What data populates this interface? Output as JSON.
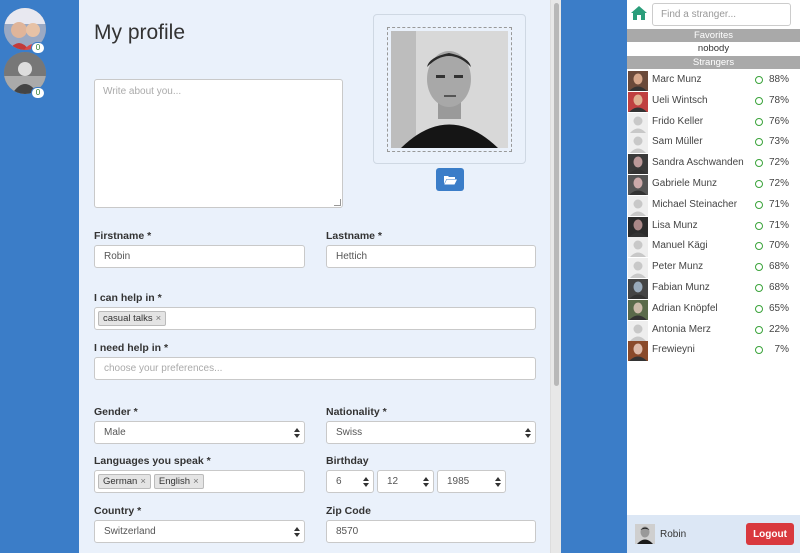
{
  "chats": [
    {
      "badge": "0"
    },
    {
      "badge": "0"
    }
  ],
  "profile": {
    "title": "My profile",
    "about_placeholder": "Write about you...",
    "firstname_label": "Firstname *",
    "firstname_value": "Robin",
    "lastname_label": "Lastname *",
    "lastname_value": "Hettich",
    "help_in_label": "I can help in *",
    "help_in_tags": [
      "casual talks"
    ],
    "need_help_label": "I need help in *",
    "need_help_placeholder": "choose your preferences...",
    "gender_label": "Gender *",
    "gender_value": "Male",
    "nationality_label": "Nationality *",
    "nationality_value": "Swiss",
    "languages_label": "Languages you speak *",
    "languages_tags": [
      "German",
      "English"
    ],
    "birthday_label": "Birthday",
    "birthday_day": "6",
    "birthday_month": "12",
    "birthday_year": "1985",
    "country_label": "Country *",
    "country_value": "Switzerland",
    "zip_label": "Zip Code",
    "zip_value": "8570",
    "tag_remove": "×"
  },
  "sidebar": {
    "search_placeholder": "Find a stranger...",
    "favorites_label": "Favorites",
    "favorites_empty": "nobody",
    "strangers_label": "Strangers",
    "status_color": "#3aa33a",
    "users": [
      {
        "name": "Marc Munz",
        "pct": "88%"
      },
      {
        "name": "Ueli Wintsch",
        "pct": "78%"
      },
      {
        "name": "Frido Keller",
        "pct": "76%"
      },
      {
        "name": "Sam Müller",
        "pct": "73%"
      },
      {
        "name": "Sandra Aschwanden",
        "pct": "72%"
      },
      {
        "name": "Gabriele Munz",
        "pct": "72%"
      },
      {
        "name": "Michael Steinacher",
        "pct": "71%"
      },
      {
        "name": "Lisa Munz",
        "pct": "71%"
      },
      {
        "name": "Manuel Kägi",
        "pct": "70%"
      },
      {
        "name": "Peter Munz",
        "pct": "68%"
      },
      {
        "name": "Fabian Munz",
        "pct": "68%"
      },
      {
        "name": "Adrian Knöpfel",
        "pct": "65%"
      },
      {
        "name": "Antonia Merz",
        "pct": "22%"
      },
      {
        "name": "Frewieyni",
        "pct": "7%"
      }
    ]
  },
  "footer": {
    "user_name": "Robin",
    "logout_label": "Logout"
  },
  "colors": {
    "brand_blue": "#3b7dc8",
    "logout_red": "#d9393e"
  }
}
